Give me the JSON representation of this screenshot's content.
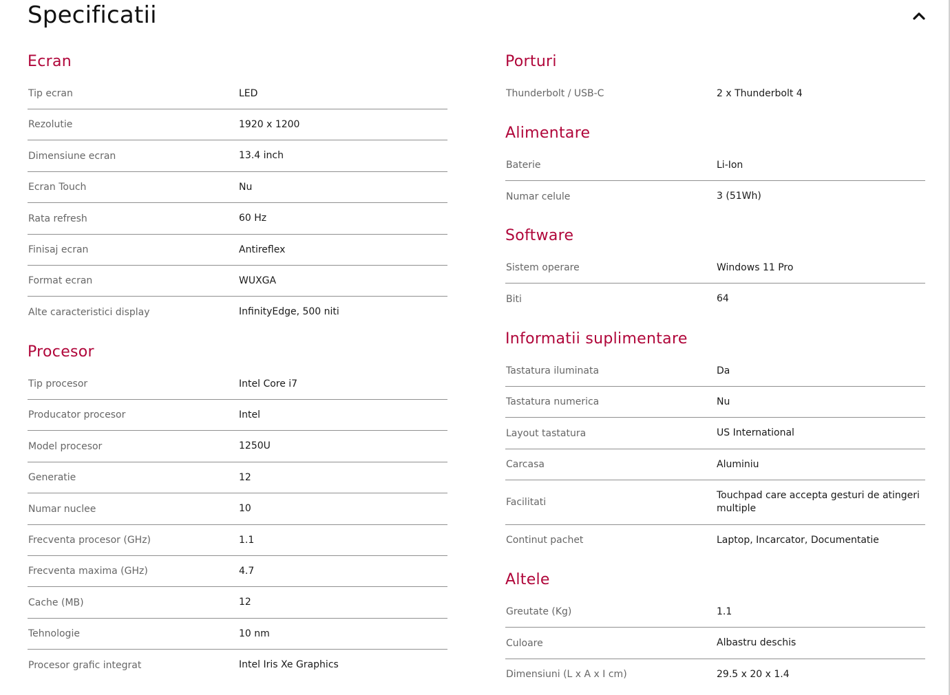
{
  "page": {
    "title": "Specificatii"
  },
  "sections": {
    "ecran": {
      "title": "Ecran",
      "rows": [
        {
          "label": "Tip ecran",
          "value": "LED"
        },
        {
          "label": "Rezolutie",
          "value": "1920 x 1200"
        },
        {
          "label": "Dimensiune ecran",
          "value": "13.4 inch"
        },
        {
          "label": "Ecran Touch",
          "value": "Nu"
        },
        {
          "label": "Rata refresh",
          "value": "60 Hz"
        },
        {
          "label": "Finisaj ecran",
          "value": "Antireflex"
        },
        {
          "label": "Format ecran",
          "value": "WUXGA"
        },
        {
          "label": "Alte caracteristici display",
          "value": "InfinityEdge, 500 niti"
        }
      ]
    },
    "procesor": {
      "title": "Procesor",
      "rows": [
        {
          "label": "Tip procesor",
          "value": "Intel Core i7"
        },
        {
          "label": "Producator procesor",
          "value": "Intel"
        },
        {
          "label": "Model procesor",
          "value": "1250U"
        },
        {
          "label": "Generatie",
          "value": "12"
        },
        {
          "label": "Numar nuclee",
          "value": "10"
        },
        {
          "label": "Frecventa procesor (GHz)",
          "value": "1.1"
        },
        {
          "label": "Frecventa maxima (GHz)",
          "value": "4.7"
        },
        {
          "label": "Cache (MB)",
          "value": "12"
        },
        {
          "label": "Tehnologie",
          "value": "10 nm"
        },
        {
          "label": "Procesor grafic integrat",
          "value": "Intel Iris Xe Graphics"
        }
      ]
    },
    "porturi": {
      "title": "Porturi",
      "rows": [
        {
          "label": "Thunderbolt / USB-C",
          "value": "2 x Thunderbolt 4"
        }
      ]
    },
    "alimentare": {
      "title": "Alimentare",
      "rows": [
        {
          "label": "Baterie",
          "value": "Li-Ion"
        },
        {
          "label": "Numar celule",
          "value": "3 (51Wh)"
        }
      ]
    },
    "software": {
      "title": "Software",
      "rows": [
        {
          "label": "Sistem operare",
          "value": "Windows 11 Pro"
        },
        {
          "label": "Biti",
          "value": "64"
        }
      ]
    },
    "informatii": {
      "title": "Informatii suplimentare",
      "rows": [
        {
          "label": "Tastatura iluminata",
          "value": "Da"
        },
        {
          "label": "Tastatura numerica",
          "value": "Nu"
        },
        {
          "label": "Layout tastatura",
          "value": "US International"
        },
        {
          "label": "Carcasa",
          "value": "Aluminiu"
        },
        {
          "label": "Facilitati",
          "value": "Touchpad care accepta gesturi de atingeri multiple"
        },
        {
          "label": "Continut pachet",
          "value": "Laptop, Incarcator, Documentatie"
        }
      ]
    },
    "altele": {
      "title": "Altele",
      "rows": [
        {
          "label": "Greutate (Kg)",
          "value": "1.1"
        },
        {
          "label": "Culoare",
          "value": "Albastru deschis"
        },
        {
          "label": "Dimensiuni (L x A x I cm)",
          "value": "29.5 x 20 x 1.4"
        }
      ]
    }
  },
  "icons": {
    "collapse": "chevron-up-icon"
  },
  "colors": {
    "accent": "#b0063a",
    "label": "#666666",
    "divider": "#8f8f8f"
  }
}
